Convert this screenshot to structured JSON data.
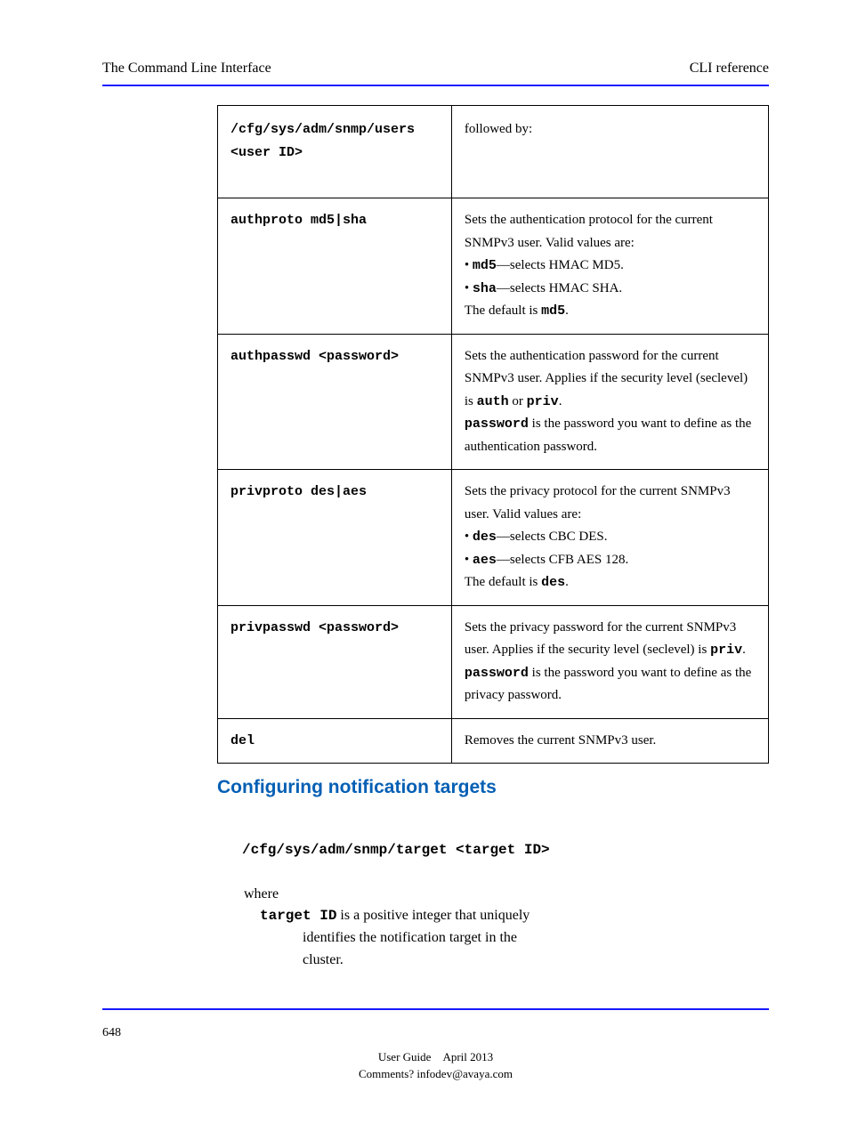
{
  "header_left": "The Command Line Interface",
  "header_right": "CLI reference",
  "page_number": "648",
  "footer1": "User Guide",
  "footer2": "April 2013",
  "footer3": "Comments? infodev@avaya.com",
  "table": {
    "header_cmd": "/cfg/sys/adm/snmp/users <user ID>",
    "header_right_cont": "followed by:",
    "rows": [
      {
        "cmd": "authproto md5|sha",
        "desc_pre": "Sets the authentication protocol for the current SNMPv3 user. Valid values are:",
        "bullet1_code": "md5",
        "bullet1_text": "—selects HMAC MD5.",
        "bullet2_code": "sha",
        "bullet2_text": "—selects HMAC SHA.",
        "default_pre": "The default is ",
        "default_code": "md5",
        "default_post": "."
      },
      {
        "cmd": "authpasswd <password>",
        "desc1_a": "Sets the authentication password for the current SNMPv3 user. Applies if the security level (seclevel) is ",
        "desc1_code1": "auth",
        "desc1_mid": " or ",
        "desc1_code2": "priv",
        "desc1_post": ".",
        "desc2_code": "password",
        "desc2_text": " is the password you want to define as the authentication password."
      },
      {
        "cmd": "privproto des|aes",
        "desc_pre": "Sets the privacy protocol for the current SNMPv3 user. Valid values are:",
        "bullet1_code": "des",
        "bullet1_text": "—selects CBC DES.",
        "bullet2_code": "aes",
        "bullet2_text": "—selects CFB AES 128.",
        "default_pre": "The default is ",
        "default_code": "des",
        "default_post": "."
      },
      {
        "cmd": "privpasswd <password>",
        "desc1_a": "Sets the privacy password for the current SNMPv3 user. Applies if the security level (seclevel) is ",
        "desc1_code1": "priv",
        "desc1_post": ".",
        "desc2_code": "password",
        "desc2_text": " is the password you want to define as the privacy password."
      },
      {
        "cmd": "del",
        "desc": "Removes the current SNMPv3 user."
      }
    ]
  },
  "section_heading": "Configuring notification targets",
  "section_path": "/cfg/sys/adm/snmp/target <target ID>",
  "body_pre": "where",
  "body_term": "target ID",
  "body_desc1": " is a positive integer that uniquely",
  "body_desc2": "identifies the notification target in the",
  "body_desc3": "cluster."
}
